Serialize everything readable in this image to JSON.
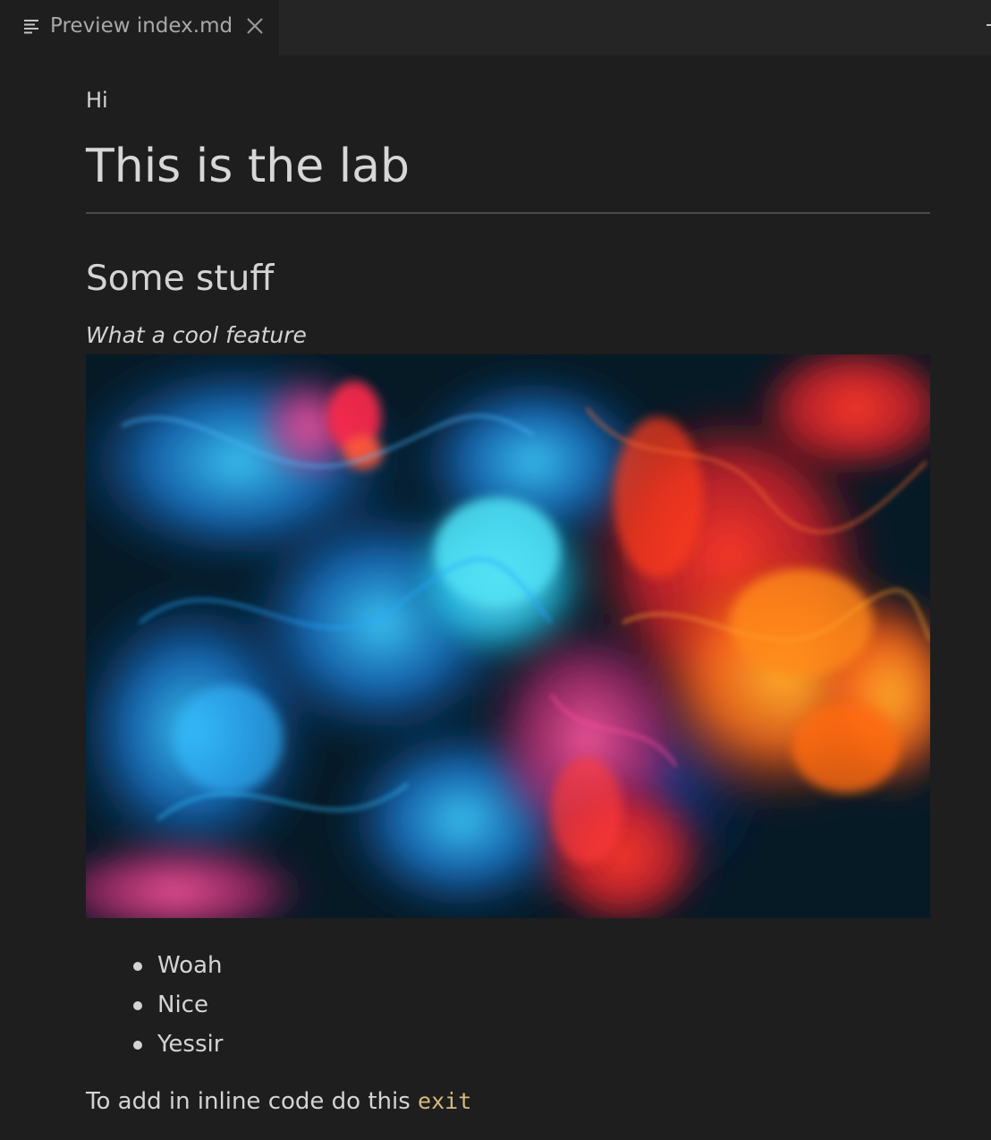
{
  "tab": {
    "label": "Preview index.md",
    "icon": "preview-lines-icon",
    "close_icon": "close-icon"
  },
  "document": {
    "paragraph_hi": "Hi",
    "heading1": "This is the lab",
    "heading2": "Some stuff",
    "emphasis": "What a cool feature",
    "image_description_icon": "ink-in-water-image",
    "list_items": [
      "Woah",
      "Nice",
      "Yessir"
    ],
    "inline_prefix": "To add in inline code do this ",
    "inline_code": "exit"
  },
  "colors": {
    "background": "#1e1e1e",
    "tabbar": "#252526",
    "text": "#d4d4d4",
    "inline_code": "#d7ba7d"
  }
}
